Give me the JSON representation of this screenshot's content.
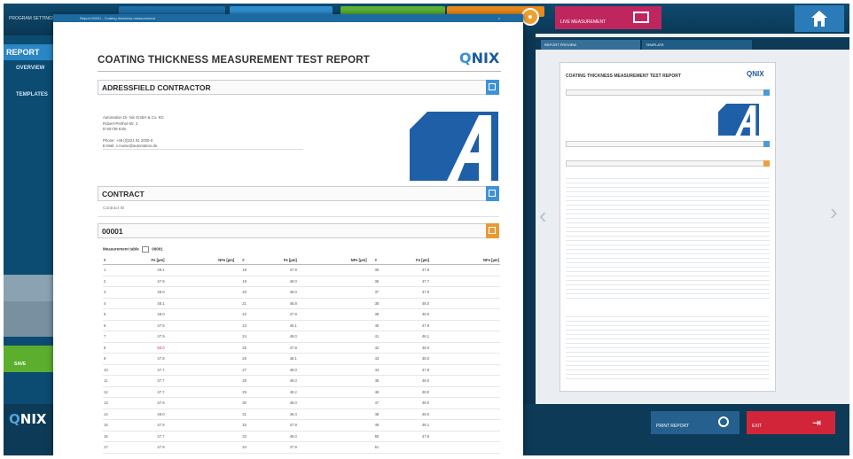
{
  "top_bar": {
    "program_label": "PROGRAM SETTINGS",
    "magenta_button_label": "LIVE MEASUREMENT"
  },
  "sidebar": {
    "report_label": "REPORT",
    "overview_label": "OVERVIEW",
    "templates_label": "TEMPLATES",
    "green_button_label": "SAVE"
  },
  "bottom_bar": {
    "logo_q": "Q",
    "logo_rest": "NIX",
    "print_button_label": "PRINT REPORT",
    "exit_button_label": "EXIT"
  },
  "preview": {
    "tab_1": "REPORT PREVIEW",
    "tab_2": "TEMPLATE",
    "arrow_left": "‹",
    "arrow_right": "›",
    "title": "COATING THICKNESS MEASUREMENT TEST REPORT",
    "logo": "QNIX"
  },
  "doc": {
    "window_title": "Report 00001 - Coating thickness measurement",
    "close": "x",
    "title": "COATING THICKNESS MEASUREMENT TEST REPORT",
    "logo_q": "Q",
    "logo_rest": "NIX",
    "address_section": "ADRESSFIELD CONTRACTOR",
    "address_lines": [
      "Automation Dr. Nix GmbH & Co. KG",
      "Robert-Perthel-Str. 2",
      "D-50739 Köln"
    ],
    "phone": "Phone: +49 (0)221 91 2000-0",
    "email": "E-Mail: n.nusse@automation.de",
    "contract_section": "CONTRACT",
    "contract_id_label": "Contract ID",
    "contract_number": "00001",
    "measurement_table_label": "Measurement table",
    "measurement_table_id": "00001",
    "columns": [
      "#",
      "Fe [µm]",
      "NFe [µm]",
      "#",
      "Fe [µm]",
      "NFe [µm]",
      "#",
      "Fe [µm]",
      "NFe [µm]"
    ],
    "rows": [
      {
        "n1": "1",
        "fe1": "48.1",
        "n2": "18",
        "fe2": "47.9",
        "n3": "35",
        "fe3": "47.9"
      },
      {
        "n1": "2",
        "fe1": "47.9",
        "n2": "19",
        "fe2": "48.0",
        "n3": "36",
        "fe3": "47.7"
      },
      {
        "n1": "3",
        "fe1": "48.0",
        "n2": "20",
        "fe2": "48.0",
        "n3": "37",
        "fe3": "47.9"
      },
      {
        "n1": "4",
        "fe1": "48.1",
        "n2": "21",
        "fe2": "48.8",
        "n3": "38",
        "fe3": "48.0"
      },
      {
        "n1": "5",
        "fe1": "48.0",
        "n2": "22",
        "fe2": "47.9",
        "n3": "39",
        "fe3": "48.0"
      },
      {
        "n1": "6",
        "fe1": "47.9",
        "n2": "23",
        "fe2": "48.1",
        "n3": "40",
        "fe3": "47.9"
      },
      {
        "n1": "7",
        "fe1": "47.9",
        "n2": "24",
        "fe2": "48.0",
        "n3": "41",
        "fe3": "48.1"
      },
      {
        "n1": "8",
        "fe1": "50.0",
        "n2": "25",
        "fe2": "47.9",
        "n3": "42",
        "fe3": "48.0"
      },
      {
        "n1": "9",
        "fe1": "47.9",
        "n2": "26",
        "fe2": "48.1",
        "n3": "43",
        "fe3": "48.0"
      },
      {
        "n1": "10",
        "fe1": "47.7",
        "n2": "27",
        "fe2": "48.0",
        "n3": "44",
        "fe3": "47.9"
      },
      {
        "n1": "11",
        "fe1": "47.7",
        "n2": "28",
        "fe2": "48.0",
        "n3": "45",
        "fe3": "48.0"
      },
      {
        "n1": "12",
        "fe1": "47.7",
        "n2": "29",
        "fe2": "48.2",
        "n3": "46",
        "fe3": "48.0"
      },
      {
        "n1": "13",
        "fe1": "47.9",
        "n2": "30",
        "fe2": "48.0",
        "n3": "47",
        "fe3": "48.0"
      },
      {
        "n1": "14",
        "fe1": "48.0",
        "n2": "31",
        "fe2": "48.4",
        "n3": "48",
        "fe3": "48.0"
      },
      {
        "n1": "15",
        "fe1": "47.9",
        "n2": "32",
        "fe2": "47.9",
        "n3": "49",
        "fe3": "48.1"
      },
      {
        "n1": "16",
        "fe1": "47.7",
        "n2": "33",
        "fe2": "48.0",
        "n3": "50",
        "fe3": "47.9"
      },
      {
        "n1": "17",
        "fe1": "47.9",
        "n2": "34",
        "fe2": "47.9",
        "n3": "51",
        "fe3": ""
      }
    ],
    "highlight_color": "#d03030"
  },
  "colors": {
    "brand_blue": "#1a5a9b",
    "accent_blue": "#3d93d6",
    "accent_orange": "#e99a35",
    "background_dark": "#0b3550"
  }
}
